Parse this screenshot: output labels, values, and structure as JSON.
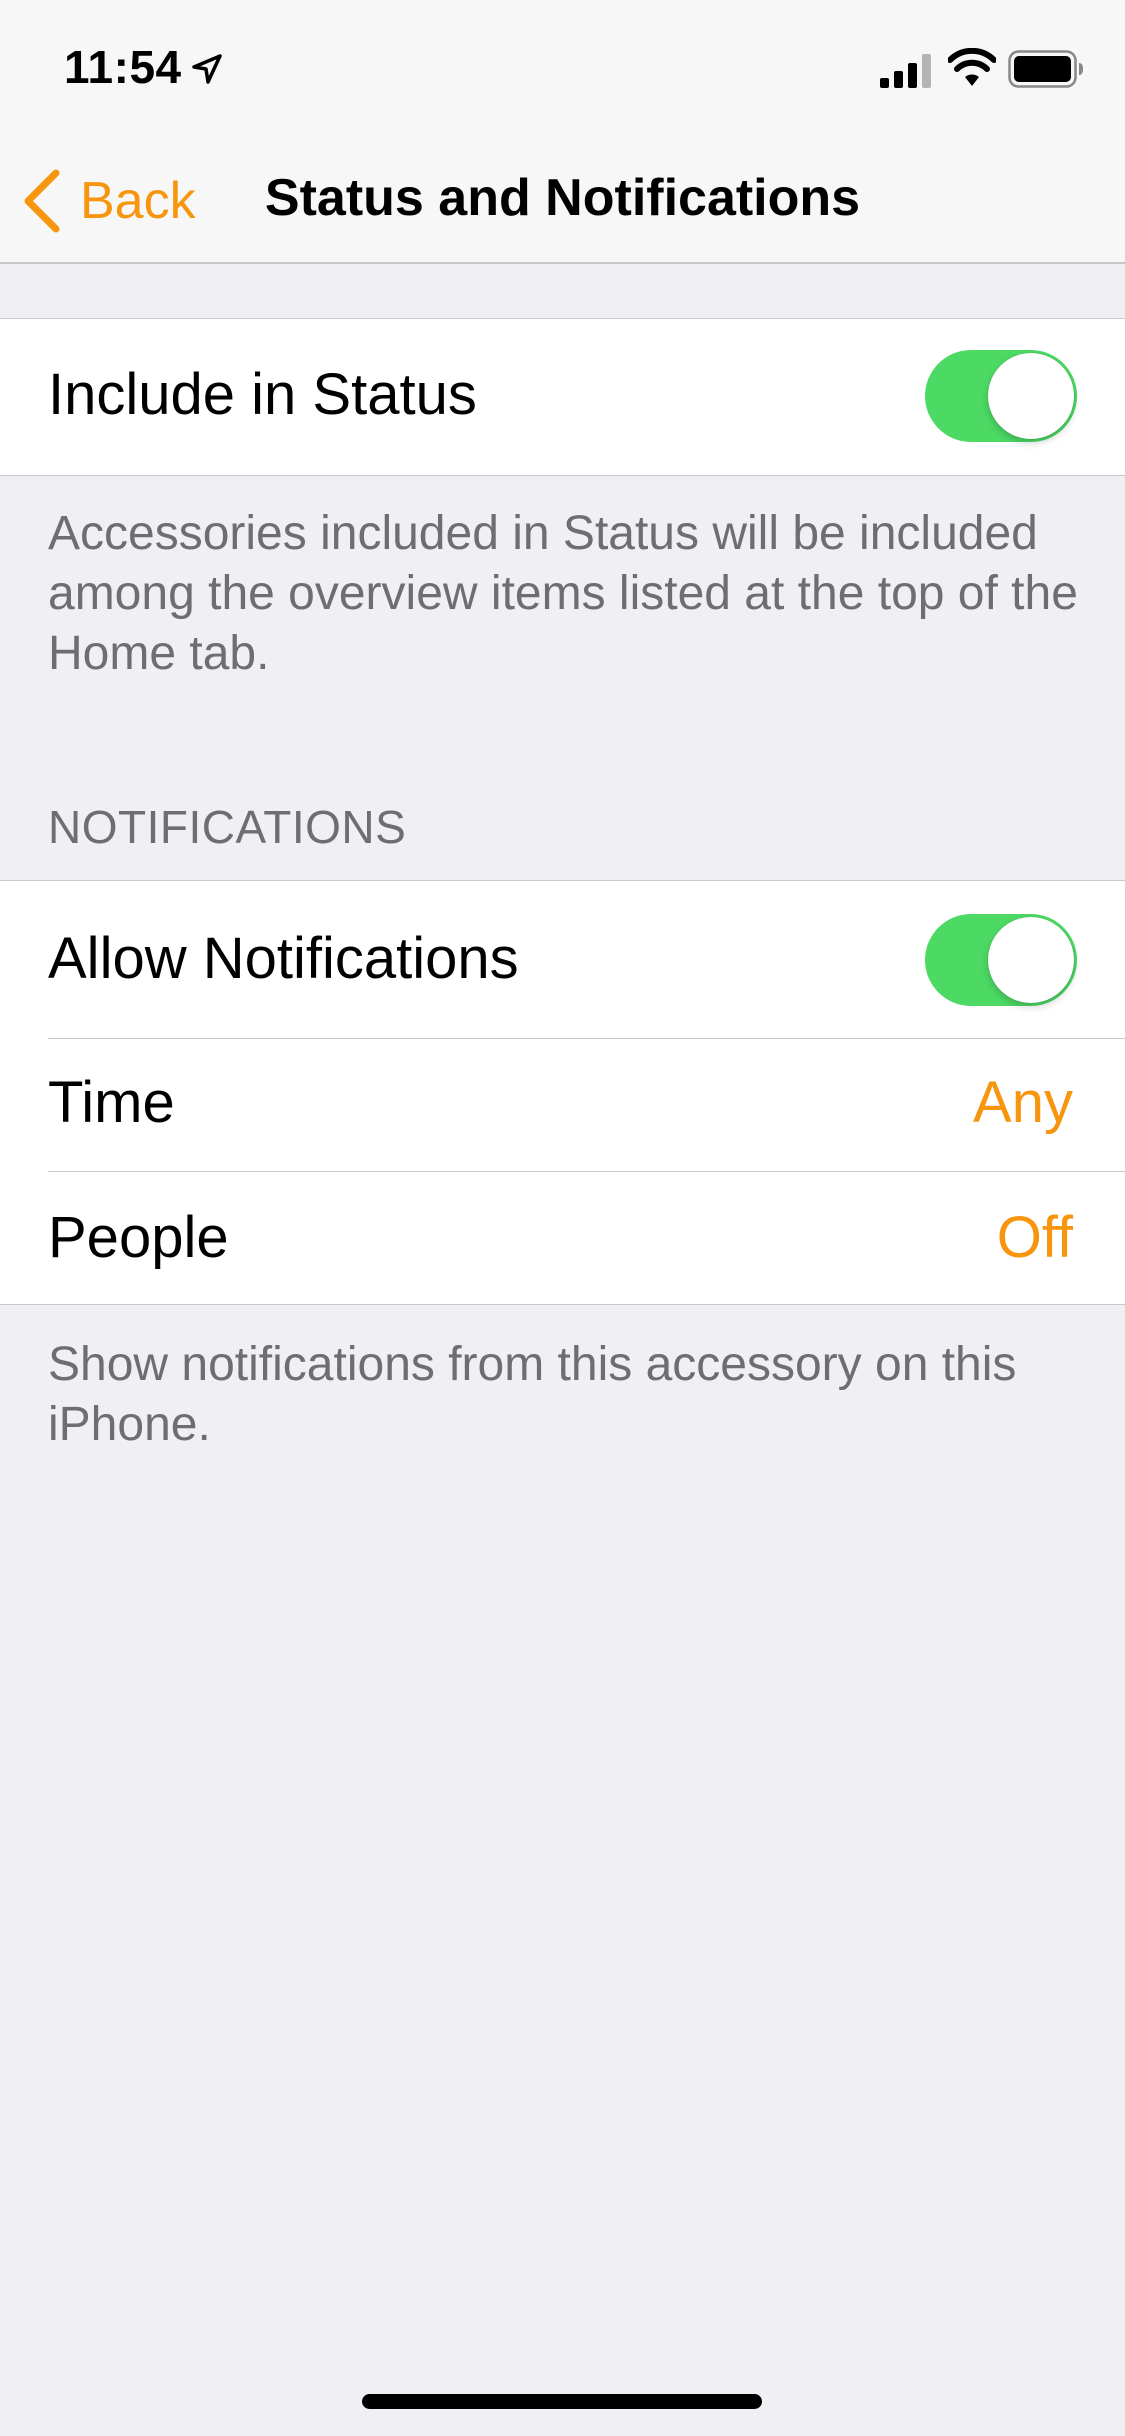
{
  "status_bar": {
    "time": "11:54"
  },
  "nav": {
    "back_label": "Back",
    "title": "Status and Notifications"
  },
  "status_group": {
    "include_label": "Include in Status",
    "include_on": true,
    "footer": "Accessories included in Status will be included among the overview items listed at the top of the Home tab."
  },
  "notifications_group": {
    "header": "NOTIFICATIONS",
    "allow_label": "Allow Notifications",
    "allow_on": true,
    "time_label": "Time",
    "time_value": "Any",
    "people_label": "People",
    "people_value": "Off",
    "footer": "Show notifications from this accessory on this iPhone."
  },
  "colors": {
    "accent": "#F7960E",
    "toggle_on": "#4CD964",
    "background": "#EFEFF4",
    "secondary_text": "#6D6D72"
  }
}
